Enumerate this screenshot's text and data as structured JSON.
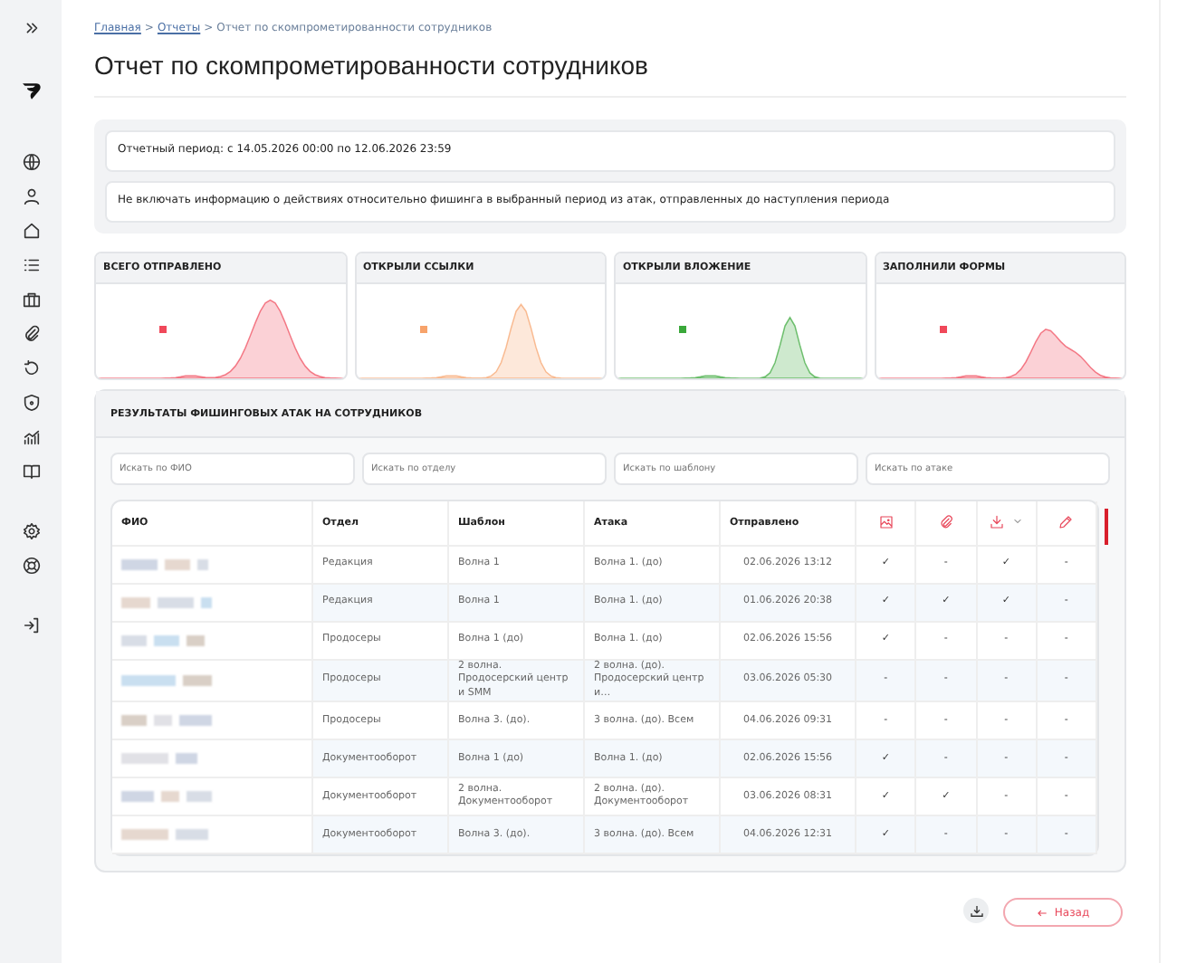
{
  "breadcrumb": {
    "separator": ">",
    "items": [
      {
        "label": "Главная",
        "link": true
      },
      {
        "label": "Отчеты",
        "link": true
      },
      {
        "label": "Отчет по скомпрометированности сотрудников",
        "link": false
      }
    ]
  },
  "title": "Отчет по скомпрометированности сотрудников",
  "period": "Отчетный период:  с 14.05.2026 00:00 по 12.06.2026 23:59",
  "exclude_note": "Не включать информацию о действиях относительно фишинга в выбранный период из атак, отправленных до наступления периода",
  "stat_cards": [
    {
      "title": "ВСЕГО ОТПРАВЛЕНО",
      "color": "#f0485a"
    },
    {
      "title": "ОТКРЫЛИ ССЫЛКИ",
      "color": "#f7a36b"
    },
    {
      "title": "ОТКРЫЛИ ВЛОЖЕНИЕ",
      "color": "#3aa83a"
    },
    {
      "title": "ЗАПОЛНИЛИ ФОРМЫ",
      "color": "#f0485a"
    }
  ],
  "results": {
    "title": "РЕЗУЛЬТАТЫ ФИШИНГОВЫХ АТАК НА СОТРУДНИКОВ",
    "filters": [
      {
        "placeholder": "Искать по ФИО"
      },
      {
        "placeholder": "Искать по отделу"
      },
      {
        "placeholder": "Искать по шаблону"
      },
      {
        "placeholder": "Искать по атаке"
      }
    ],
    "columns": [
      {
        "kind": "text",
        "label": "ФИО"
      },
      {
        "kind": "text",
        "label": "Отдел"
      },
      {
        "kind": "text",
        "label": "Шаблон"
      },
      {
        "kind": "text",
        "label": "Атака"
      },
      {
        "kind": "text",
        "label": "Отправлено"
      },
      {
        "kind": "icon",
        "menu": false
      },
      {
        "kind": "icon",
        "menu": false
      },
      {
        "kind": "icon",
        "menu": true
      },
      {
        "kind": "icon",
        "menu": false
      }
    ],
    "rows": [
      {
        "department": "Редакция",
        "template": "Волна 1",
        "attack": "Волна 1. (до)",
        "sent": "02.06.2026 13:12",
        "marks": [
          "✓",
          "-",
          "✓",
          "-"
        ]
      },
      {
        "department": "Редакция",
        "template": "Волна 1",
        "attack": "Волна 1. (до)",
        "sent": "01.06.2026 20:38",
        "marks": [
          "✓",
          "✓",
          "✓",
          "-"
        ]
      },
      {
        "department": "Продосеры",
        "template": "Волна 1 (до)",
        "attack": "Волна 1. (до)",
        "sent": "02.06.2026 15:56",
        "marks": [
          "✓",
          "-",
          "-",
          "-"
        ]
      },
      {
        "department": "Продосеры",
        "template": "2 волна. Продосерский центр и SMM",
        "attack": "2 волна. (до). Продосерский центр и…",
        "sent": "03.06.2026 05:30",
        "marks": [
          "-",
          "-",
          "-",
          "-"
        ]
      },
      {
        "department": "Продосеры",
        "template": "Волна 3. (до).",
        "attack": "3 волна. (до). Всем",
        "sent": "04.06.2026 09:31",
        "marks": [
          "-",
          "-",
          "-",
          "-"
        ]
      },
      {
        "department": "Документооборот",
        "template": "Волна 1 (до)",
        "attack": "Волна 1. (до)",
        "sent": "02.06.2026 15:56",
        "marks": [
          "✓",
          "-",
          "-",
          "-"
        ]
      },
      {
        "department": "Документооборот",
        "template": "2 волна. Документооборот",
        "attack": "2 волна. (до). Документооборот",
        "sent": "03.06.2026 08:31",
        "marks": [
          "✓",
          "✓",
          "-",
          "-"
        ]
      },
      {
        "department": "Документооборот",
        "template": "Волна 3. (до).",
        "attack": "3 волна. (до). Всем",
        "sent": "04.06.2026 12:31",
        "marks": [
          "✓",
          "-",
          "-",
          "-"
        ]
      }
    ]
  },
  "back_button": "Назад"
}
